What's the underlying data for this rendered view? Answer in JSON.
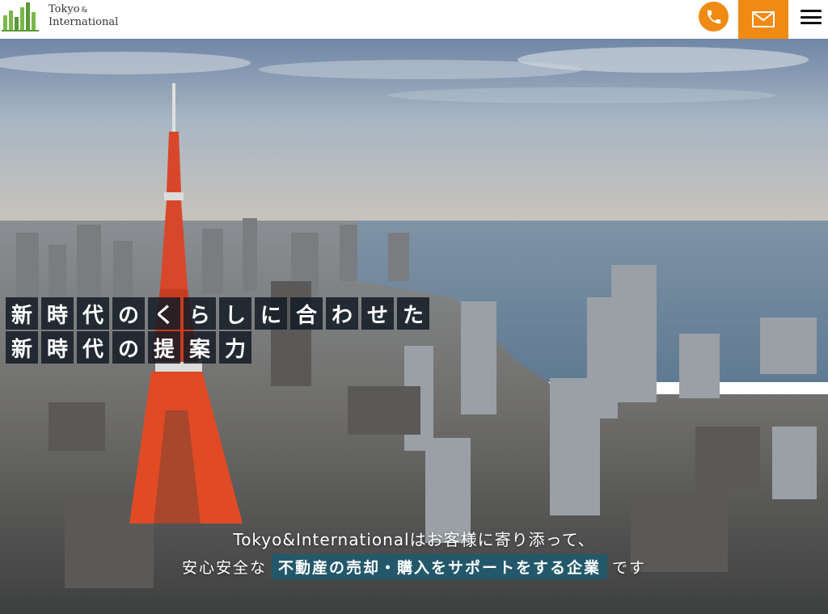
{
  "header": {
    "logo_line1": "Tokyo",
    "logo_amp": "&",
    "logo_line2": "International",
    "phone_icon": "phone-icon",
    "mail_icon": "mail-icon",
    "menu_icon": "hamburger-menu-icon",
    "accent_color": "#f08a12"
  },
  "hero": {
    "headline_row1": [
      "新",
      "時",
      "代",
      "の",
      "く",
      "ら",
      "し",
      "に",
      "合",
      "わ",
      "せ",
      "た"
    ],
    "headline_row2": [
      "新",
      "時",
      "代",
      "の",
      "提",
      "案",
      "力"
    ],
    "sub_line1": "Tokyo&Internationalはお客様に寄り添って、",
    "sub_line2_pre": "安心安全な",
    "sub_line2_highlight": "不動産の売却・購入をサポートをする企業",
    "sub_line2_post": "です"
  }
}
